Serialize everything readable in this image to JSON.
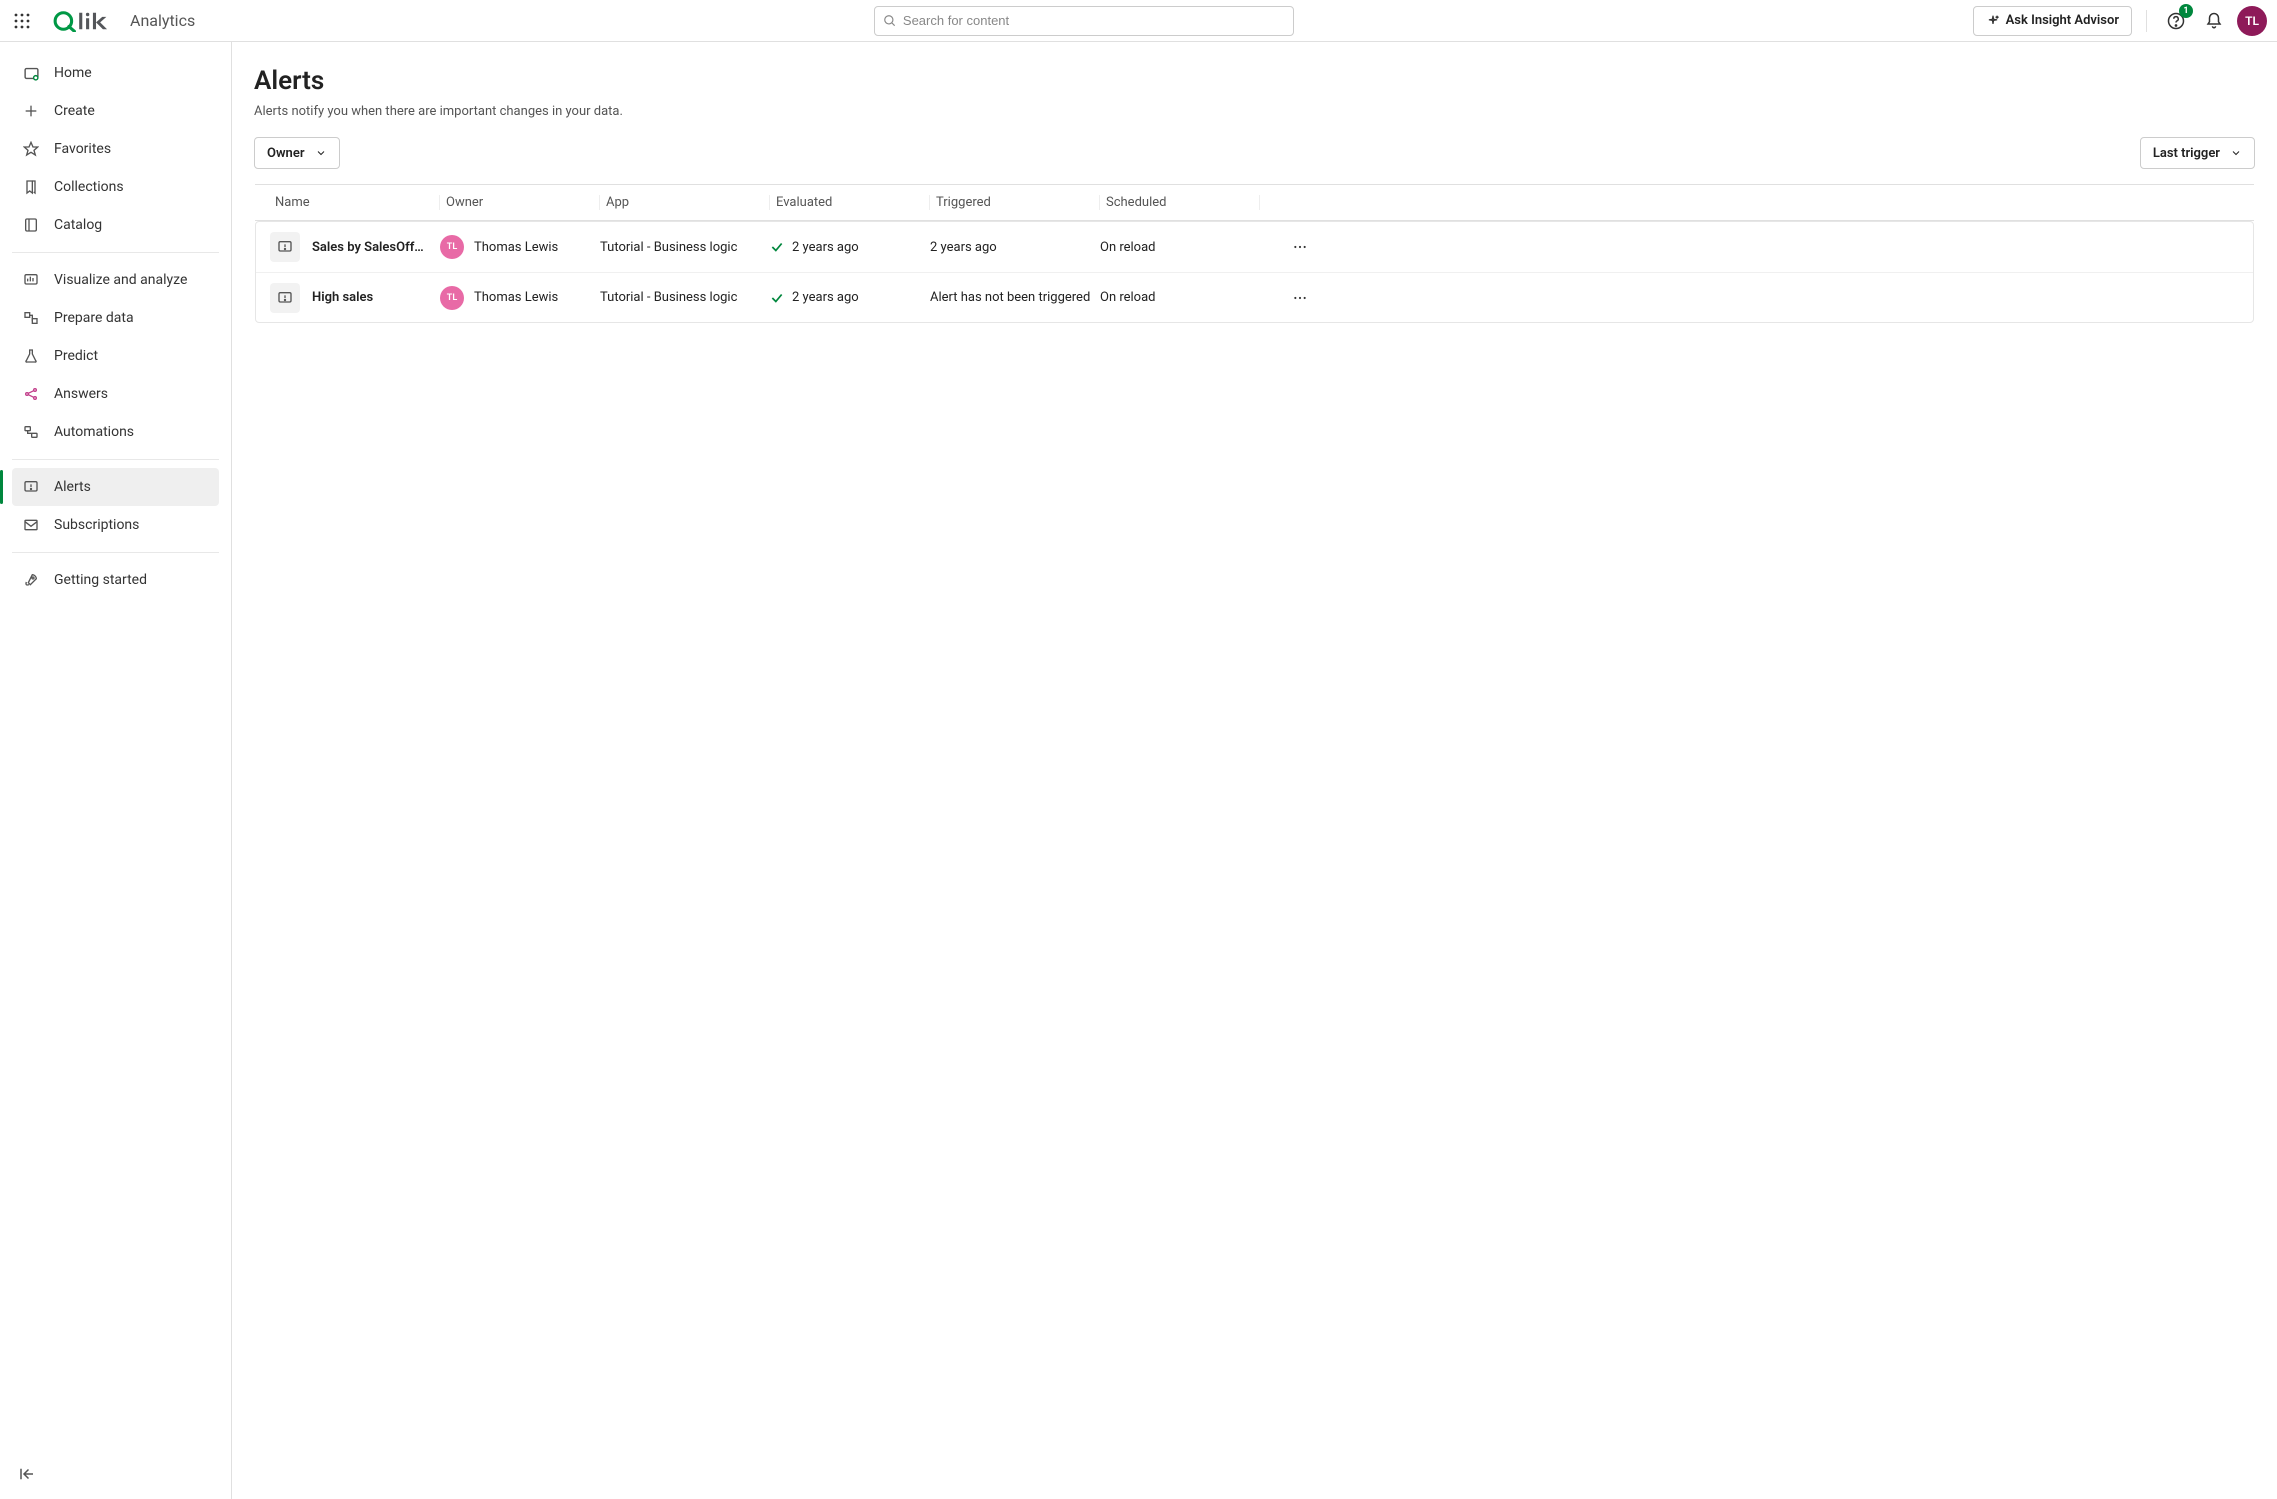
{
  "header": {
    "brand_sub": "Analytics",
    "search_placeholder": "Search for content",
    "ask_label": "Ask Insight Advisor",
    "help_badge": "1",
    "avatar_initials": "TL"
  },
  "sidebar": {
    "items": [
      {
        "label": "Home"
      },
      {
        "label": "Create"
      },
      {
        "label": "Favorites"
      },
      {
        "label": "Collections"
      },
      {
        "label": "Catalog"
      }
    ],
    "items2": [
      {
        "label": "Visualize and analyze"
      },
      {
        "label": "Prepare data"
      },
      {
        "label": "Predict"
      },
      {
        "label": "Answers"
      },
      {
        "label": "Automations"
      }
    ],
    "items3": [
      {
        "label": "Alerts"
      },
      {
        "label": "Subscriptions"
      }
    ],
    "items4": [
      {
        "label": "Getting started"
      }
    ]
  },
  "page": {
    "title": "Alerts",
    "description": "Alerts notify you when there are important changes in your data.",
    "owner_filter": "Owner",
    "sort_filter": "Last trigger"
  },
  "table": {
    "columns": {
      "name": "Name",
      "owner": "Owner",
      "app": "App",
      "evaluated": "Evaluated",
      "triggered": "Triggered",
      "scheduled": "Scheduled"
    },
    "rows": [
      {
        "name": "Sales by SalesOff…",
        "owner": "Thomas Lewis",
        "owner_initials": "TL",
        "app": "Tutorial - Business logic",
        "evaluated": "2 years ago",
        "triggered": "2 years ago",
        "scheduled": "On reload"
      },
      {
        "name": "High sales",
        "owner": "Thomas Lewis",
        "owner_initials": "TL",
        "app": "Tutorial - Business logic",
        "evaluated": "2 years ago",
        "triggered": "Alert has not been triggered",
        "scheduled": "On reload"
      }
    ]
  }
}
